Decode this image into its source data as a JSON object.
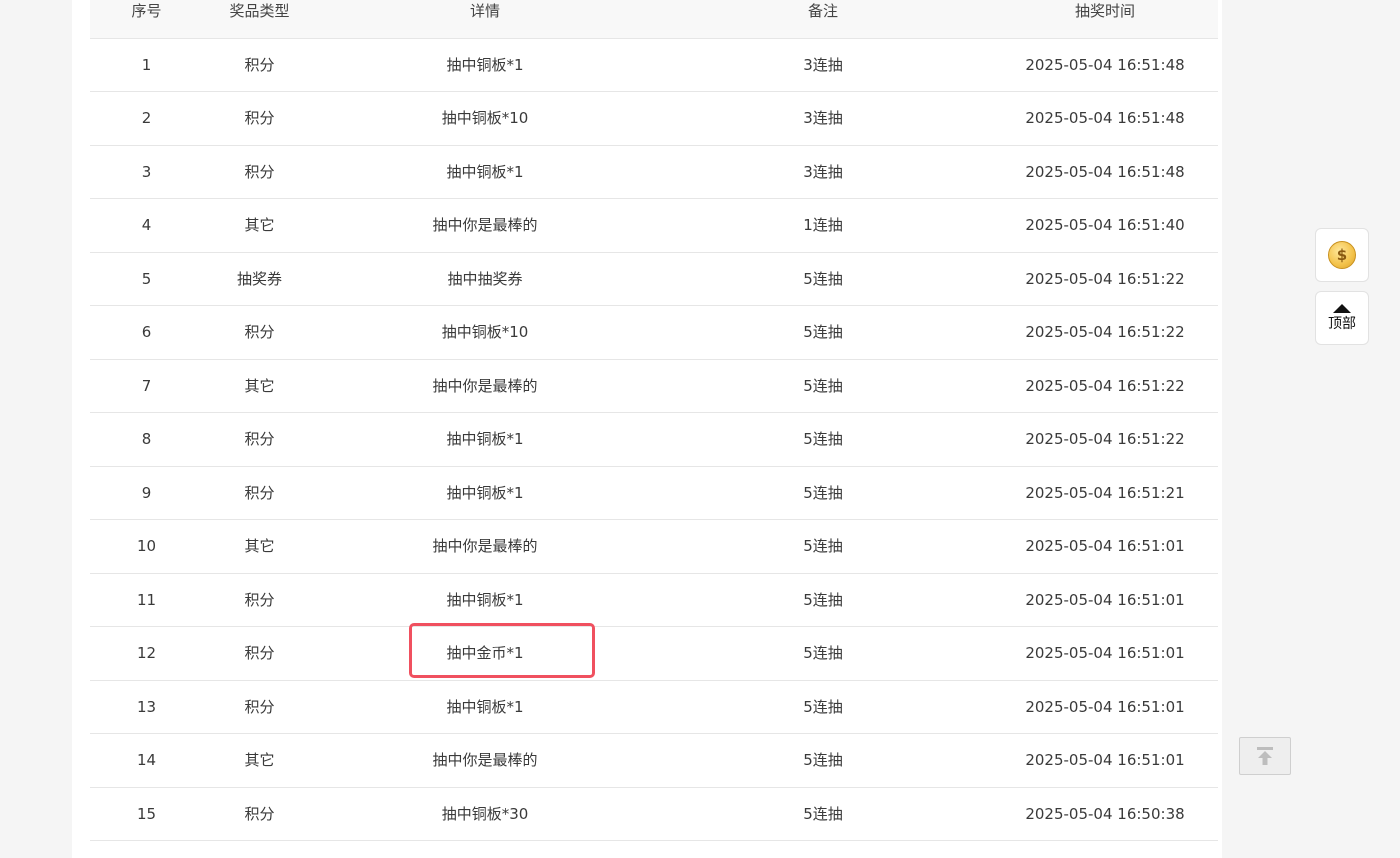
{
  "table": {
    "headers": [
      "序号",
      "奖品类型",
      "详情",
      "备注",
      "抽奖时间"
    ],
    "rows": [
      {
        "no": "1",
        "type": "积分",
        "detail": "抽中铜板*1",
        "note": "3连抽",
        "time": "2025-05-04 16:51:48"
      },
      {
        "no": "2",
        "type": "积分",
        "detail": "抽中铜板*10",
        "note": "3连抽",
        "time": "2025-05-04 16:51:48"
      },
      {
        "no": "3",
        "type": "积分",
        "detail": "抽中铜板*1",
        "note": "3连抽",
        "time": "2025-05-04 16:51:48"
      },
      {
        "no": "4",
        "type": "其它",
        "detail": "抽中你是最棒的",
        "note": "1连抽",
        "time": "2025-05-04 16:51:40"
      },
      {
        "no": "5",
        "type": "抽奖券",
        "detail": "抽中抽奖券",
        "note": "5连抽",
        "time": "2025-05-04 16:51:22"
      },
      {
        "no": "6",
        "type": "积分",
        "detail": "抽中铜板*10",
        "note": "5连抽",
        "time": "2025-05-04 16:51:22"
      },
      {
        "no": "7",
        "type": "其它",
        "detail": "抽中你是最棒的",
        "note": "5连抽",
        "time": "2025-05-04 16:51:22"
      },
      {
        "no": "8",
        "type": "积分",
        "detail": "抽中铜板*1",
        "note": "5连抽",
        "time": "2025-05-04 16:51:22"
      },
      {
        "no": "9",
        "type": "积分",
        "detail": "抽中铜板*1",
        "note": "5连抽",
        "time": "2025-05-04 16:51:21"
      },
      {
        "no": "10",
        "type": "其它",
        "detail": "抽中你是最棒的",
        "note": "5连抽",
        "time": "2025-05-04 16:51:01"
      },
      {
        "no": "11",
        "type": "积分",
        "detail": "抽中铜板*1",
        "note": "5连抽",
        "time": "2025-05-04 16:51:01"
      },
      {
        "no": "12",
        "type": "积分",
        "detail": "抽中金币*1",
        "note": "5连抽",
        "time": "2025-05-04 16:51:01"
      },
      {
        "no": "13",
        "type": "积分",
        "detail": "抽中铜板*1",
        "note": "5连抽",
        "time": "2025-05-04 16:51:01"
      },
      {
        "no": "14",
        "type": "其它",
        "detail": "抽中你是最棒的",
        "note": "5连抽",
        "time": "2025-05-04 16:51:01"
      },
      {
        "no": "15",
        "type": "积分",
        "detail": "抽中铜板*30",
        "note": "5连抽",
        "time": "2025-05-04 16:50:38"
      }
    ]
  },
  "highlight": {
    "row_no": "12",
    "color": "#f0505f"
  },
  "side": {
    "coin_icon": "coin-icon",
    "coin_symbol": "$",
    "top_label": "顶部",
    "top_icon": "triangle-up-icon",
    "back_to_top_icon": "arrow-up-to-line-icon"
  }
}
